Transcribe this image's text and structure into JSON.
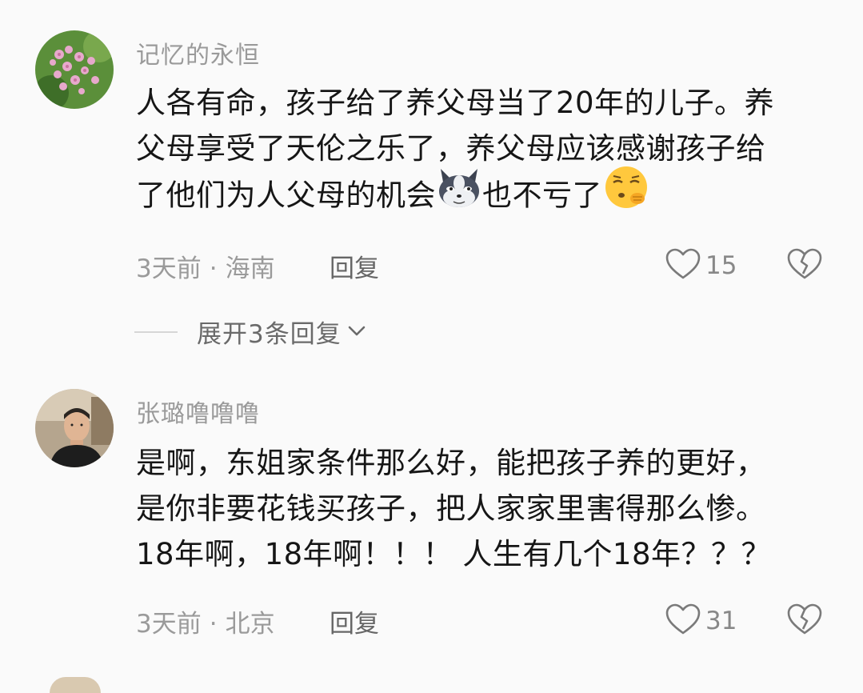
{
  "comments": [
    {
      "username": "记忆的永恒",
      "lines": [
        "人各有命，孩子给了养父母当了20年的儿子。养",
        "父母享受了天伦之乐了，养父母应该感谢孩子给"
      ],
      "line3_a": "了他们为人父母的机会",
      "line3_b": "也不亏了",
      "emoji_1": "wolf-face-emoji",
      "emoji_2": "sighing-face-emoji",
      "time": "3天前",
      "separator": "·",
      "location": "海南",
      "reply_label": "回复",
      "like_count": "15",
      "expand_label": "展开3条回复"
    },
    {
      "username": "张璐噜噜噜",
      "lines": [
        "是啊，东姐家条件那么好，能把孩子养的更好，",
        "是你非要花钱买孩子，把人家家里害得那么惨。",
        "18年啊，18年啊！！！ 人生有几个18年？？？"
      ],
      "time": "3天前",
      "separator": "·",
      "location": "北京",
      "reply_label": "回复",
      "like_count": "31"
    }
  ],
  "icons": {
    "like": "heart-outline-icon",
    "dislike": "broken-heart-icon",
    "expand": "chevron-down-icon"
  },
  "colors": {
    "background": "#fafafa",
    "username": "#9a9a9a",
    "text": "#161616",
    "meta": "#9a9a9a"
  }
}
